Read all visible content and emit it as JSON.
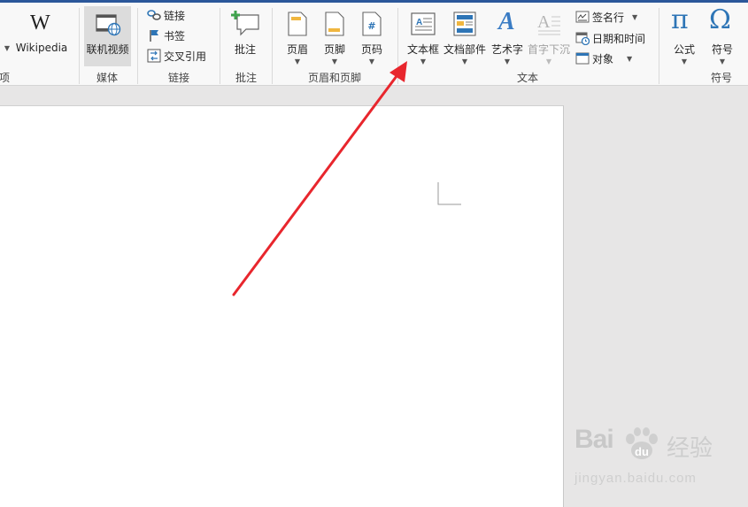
{
  "ribbon": {
    "addins": {
      "wikipedia_label": "Wikipedia",
      "group_label": "项"
    },
    "media": {
      "online_video_label": "联机视频",
      "group_label": "媒体"
    },
    "links": {
      "link_label": "链接",
      "bookmark_label": "书签",
      "cross_ref_label": "交叉引用",
      "group_label": "链接"
    },
    "comments": {
      "comment_label": "批注",
      "group_label": "批注"
    },
    "header_footer": {
      "header_label": "页眉",
      "footer_label": "页脚",
      "page_number_label": "页码",
      "group_label": "页眉和页脚"
    },
    "text": {
      "textbox_label": "文本框",
      "quickparts_label": "文档部件",
      "wordart_label": "艺术字",
      "dropcap_label": "首字下沉",
      "signature_label": "签名行",
      "datetime_label": "日期和时间",
      "object_label": "对象",
      "group_label": "文本"
    },
    "symbols": {
      "equation_label": "公式",
      "symbol_label": "符号",
      "group_label": "符号"
    }
  },
  "watermark": {
    "brand": "Bai",
    "brand_suffix": "经验",
    "url": "jingyan.baidu.com"
  },
  "colors": {
    "accent": "#2b579a",
    "arrow": "#e8262d"
  }
}
